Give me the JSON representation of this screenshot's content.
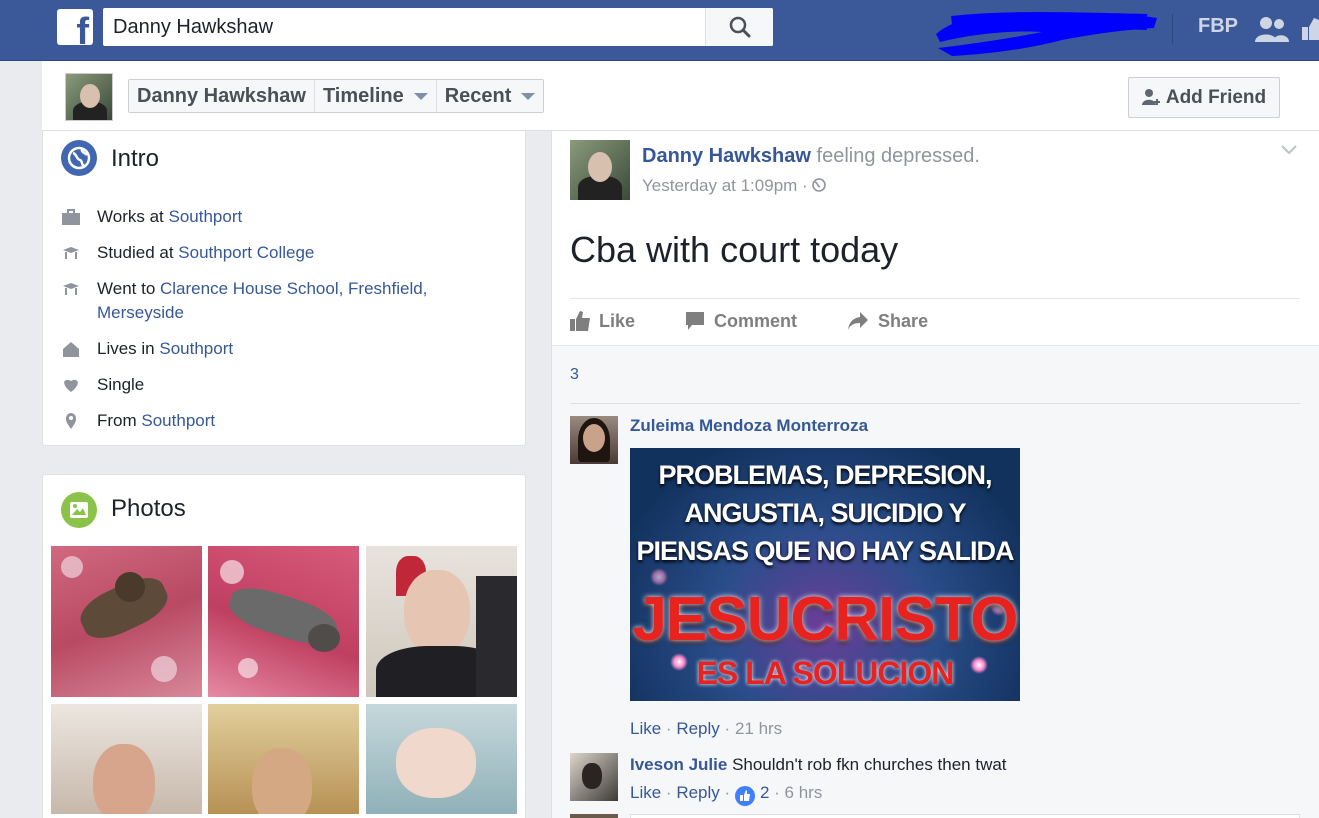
{
  "topbar": {
    "logo_letter": "f",
    "search_value": "Danny Hawkshaw",
    "shortcut_label": "FBP",
    "brand_color": "#3b5998"
  },
  "profile_bar": {
    "name": "Danny Hawkshaw",
    "timeline": "Timeline",
    "recent": "Recent",
    "add_friend": "Add Friend"
  },
  "intro": {
    "title": "Intro",
    "items": [
      {
        "icon": "briefcase-icon",
        "prefix": "Works at ",
        "link": "Southport"
      },
      {
        "icon": "graduation-cap-icon",
        "prefix": "Studied at ",
        "link": "Southport College"
      },
      {
        "icon": "graduation-cap-icon",
        "prefix": "Went to ",
        "link": "Clarence House School, Freshfield, Merseyside"
      },
      {
        "icon": "home-icon",
        "prefix": "Lives in ",
        "link": "Southport"
      },
      {
        "icon": "heart-icon",
        "prefix": "Single",
        "link": ""
      },
      {
        "icon": "location-pin-icon",
        "prefix": "From ",
        "link": "Southport"
      }
    ]
  },
  "photos": {
    "title": "Photos"
  },
  "post": {
    "author": "Danny Hawkshaw",
    "feeling": "feeling depressed.",
    "time": "Yesterday at 1:09pm",
    "time_sep": "·",
    "text": "Cba with court today",
    "actions": {
      "like": "Like",
      "comment": "Comment",
      "share": "Share"
    },
    "likes_count": "3"
  },
  "comments": [
    {
      "name": "Zuleima Mendoza Monterroza",
      "image_text": {
        "line1": "PROBLEMAS, DEPRESION,\nANGUSTIA, SUICIDIO Y\nPIENSAS QUE NO HAY SALIDA",
        "line2": "JESUCRISTO",
        "line3": "ES LA SOLUCION"
      },
      "like": "Like",
      "reply": "Reply",
      "sep": "·",
      "time": "21 hrs"
    },
    {
      "name": "Iveson Julie",
      "text": "Shouldn't rob fkn churches then twat",
      "like": "Like",
      "reply": "Reply",
      "sep": "·",
      "reactions": "2",
      "time": "6 hrs"
    }
  ]
}
